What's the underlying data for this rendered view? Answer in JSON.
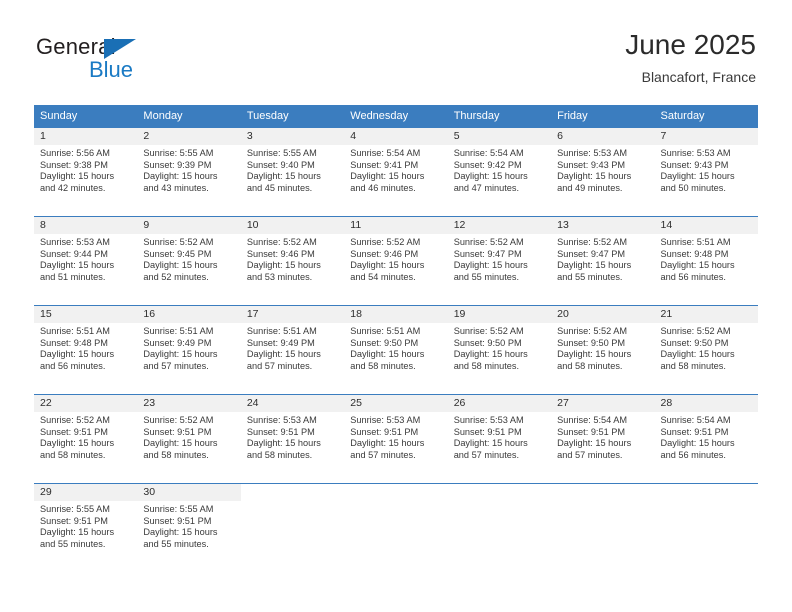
{
  "logo": {
    "word_top": "General",
    "word_bottom": "Blue",
    "triangle_color": "#1a6fb5",
    "blue_color": "#1a7ac4"
  },
  "header": {
    "title": "June 2025",
    "subtitle": "Blancafort, France"
  },
  "theme": {
    "header_blue": "#3b7dbf",
    "daynum_background": "#f1f1f1"
  },
  "weekday_headers": [
    "Sunday",
    "Monday",
    "Tuesday",
    "Wednesday",
    "Thursday",
    "Friday",
    "Saturday"
  ],
  "labels": {
    "sunrise_prefix": "Sunrise:",
    "sunset_prefix": "Sunset:",
    "daylight_prefix": "Daylight:"
  },
  "weeks": [
    [
      {
        "day": "1",
        "sunrise": "Sunrise: 5:56 AM",
        "sunset": "Sunset: 9:38 PM",
        "daylight_line1": "Daylight: 15 hours",
        "daylight_line2": "and 42 minutes."
      },
      {
        "day": "2",
        "sunrise": "Sunrise: 5:55 AM",
        "sunset": "Sunset: 9:39 PM",
        "daylight_line1": "Daylight: 15 hours",
        "daylight_line2": "and 43 minutes."
      },
      {
        "day": "3",
        "sunrise": "Sunrise: 5:55 AM",
        "sunset": "Sunset: 9:40 PM",
        "daylight_line1": "Daylight: 15 hours",
        "daylight_line2": "and 45 minutes."
      },
      {
        "day": "4",
        "sunrise": "Sunrise: 5:54 AM",
        "sunset": "Sunset: 9:41 PM",
        "daylight_line1": "Daylight: 15 hours",
        "daylight_line2": "and 46 minutes."
      },
      {
        "day": "5",
        "sunrise": "Sunrise: 5:54 AM",
        "sunset": "Sunset: 9:42 PM",
        "daylight_line1": "Daylight: 15 hours",
        "daylight_line2": "and 47 minutes."
      },
      {
        "day": "6",
        "sunrise": "Sunrise: 5:53 AM",
        "sunset": "Sunset: 9:43 PM",
        "daylight_line1": "Daylight: 15 hours",
        "daylight_line2": "and 49 minutes."
      },
      {
        "day": "7",
        "sunrise": "Sunrise: 5:53 AM",
        "sunset": "Sunset: 9:43 PM",
        "daylight_line1": "Daylight: 15 hours",
        "daylight_line2": "and 50 minutes."
      }
    ],
    [
      {
        "day": "8",
        "sunrise": "Sunrise: 5:53 AM",
        "sunset": "Sunset: 9:44 PM",
        "daylight_line1": "Daylight: 15 hours",
        "daylight_line2": "and 51 minutes."
      },
      {
        "day": "9",
        "sunrise": "Sunrise: 5:52 AM",
        "sunset": "Sunset: 9:45 PM",
        "daylight_line1": "Daylight: 15 hours",
        "daylight_line2": "and 52 minutes."
      },
      {
        "day": "10",
        "sunrise": "Sunrise: 5:52 AM",
        "sunset": "Sunset: 9:46 PM",
        "daylight_line1": "Daylight: 15 hours",
        "daylight_line2": "and 53 minutes."
      },
      {
        "day": "11",
        "sunrise": "Sunrise: 5:52 AM",
        "sunset": "Sunset: 9:46 PM",
        "daylight_line1": "Daylight: 15 hours",
        "daylight_line2": "and 54 minutes."
      },
      {
        "day": "12",
        "sunrise": "Sunrise: 5:52 AM",
        "sunset": "Sunset: 9:47 PM",
        "daylight_line1": "Daylight: 15 hours",
        "daylight_line2": "and 55 minutes."
      },
      {
        "day": "13",
        "sunrise": "Sunrise: 5:52 AM",
        "sunset": "Sunset: 9:47 PM",
        "daylight_line1": "Daylight: 15 hours",
        "daylight_line2": "and 55 minutes."
      },
      {
        "day": "14",
        "sunrise": "Sunrise: 5:51 AM",
        "sunset": "Sunset: 9:48 PM",
        "daylight_line1": "Daylight: 15 hours",
        "daylight_line2": "and 56 minutes."
      }
    ],
    [
      {
        "day": "15",
        "sunrise": "Sunrise: 5:51 AM",
        "sunset": "Sunset: 9:48 PM",
        "daylight_line1": "Daylight: 15 hours",
        "daylight_line2": "and 56 minutes."
      },
      {
        "day": "16",
        "sunrise": "Sunrise: 5:51 AM",
        "sunset": "Sunset: 9:49 PM",
        "daylight_line1": "Daylight: 15 hours",
        "daylight_line2": "and 57 minutes."
      },
      {
        "day": "17",
        "sunrise": "Sunrise: 5:51 AM",
        "sunset": "Sunset: 9:49 PM",
        "daylight_line1": "Daylight: 15 hours",
        "daylight_line2": "and 57 minutes."
      },
      {
        "day": "18",
        "sunrise": "Sunrise: 5:51 AM",
        "sunset": "Sunset: 9:50 PM",
        "daylight_line1": "Daylight: 15 hours",
        "daylight_line2": "and 58 minutes."
      },
      {
        "day": "19",
        "sunrise": "Sunrise: 5:52 AM",
        "sunset": "Sunset: 9:50 PM",
        "daylight_line1": "Daylight: 15 hours",
        "daylight_line2": "and 58 minutes."
      },
      {
        "day": "20",
        "sunrise": "Sunrise: 5:52 AM",
        "sunset": "Sunset: 9:50 PM",
        "daylight_line1": "Daylight: 15 hours",
        "daylight_line2": "and 58 minutes."
      },
      {
        "day": "21",
        "sunrise": "Sunrise: 5:52 AM",
        "sunset": "Sunset: 9:50 PM",
        "daylight_line1": "Daylight: 15 hours",
        "daylight_line2": "and 58 minutes."
      }
    ],
    [
      {
        "day": "22",
        "sunrise": "Sunrise: 5:52 AM",
        "sunset": "Sunset: 9:51 PM",
        "daylight_line1": "Daylight: 15 hours",
        "daylight_line2": "and 58 minutes."
      },
      {
        "day": "23",
        "sunrise": "Sunrise: 5:52 AM",
        "sunset": "Sunset: 9:51 PM",
        "daylight_line1": "Daylight: 15 hours",
        "daylight_line2": "and 58 minutes."
      },
      {
        "day": "24",
        "sunrise": "Sunrise: 5:53 AM",
        "sunset": "Sunset: 9:51 PM",
        "daylight_line1": "Daylight: 15 hours",
        "daylight_line2": "and 58 minutes."
      },
      {
        "day": "25",
        "sunrise": "Sunrise: 5:53 AM",
        "sunset": "Sunset: 9:51 PM",
        "daylight_line1": "Daylight: 15 hours",
        "daylight_line2": "and 57 minutes."
      },
      {
        "day": "26",
        "sunrise": "Sunrise: 5:53 AM",
        "sunset": "Sunset: 9:51 PM",
        "daylight_line1": "Daylight: 15 hours",
        "daylight_line2": "and 57 minutes."
      },
      {
        "day": "27",
        "sunrise": "Sunrise: 5:54 AM",
        "sunset": "Sunset: 9:51 PM",
        "daylight_line1": "Daylight: 15 hours",
        "daylight_line2": "and 57 minutes."
      },
      {
        "day": "28",
        "sunrise": "Sunrise: 5:54 AM",
        "sunset": "Sunset: 9:51 PM",
        "daylight_line1": "Daylight: 15 hours",
        "daylight_line2": "and 56 minutes."
      }
    ],
    [
      {
        "day": "29",
        "sunrise": "Sunrise: 5:55 AM",
        "sunset": "Sunset: 9:51 PM",
        "daylight_line1": "Daylight: 15 hours",
        "daylight_line2": "and 55 minutes."
      },
      {
        "day": "30",
        "sunrise": "Sunrise: 5:55 AM",
        "sunset": "Sunset: 9:51 PM",
        "daylight_line1": "Daylight: 15 hours",
        "daylight_line2": "and 55 minutes."
      },
      {
        "day": "",
        "sunrise": "",
        "sunset": "",
        "daylight_line1": "",
        "daylight_line2": ""
      },
      {
        "day": "",
        "sunrise": "",
        "sunset": "",
        "daylight_line1": "",
        "daylight_line2": ""
      },
      {
        "day": "",
        "sunrise": "",
        "sunset": "",
        "daylight_line1": "",
        "daylight_line2": ""
      },
      {
        "day": "",
        "sunrise": "",
        "sunset": "",
        "daylight_line1": "",
        "daylight_line2": ""
      },
      {
        "day": "",
        "sunrise": "",
        "sunset": "",
        "daylight_line1": "",
        "daylight_line2": ""
      }
    ]
  ]
}
